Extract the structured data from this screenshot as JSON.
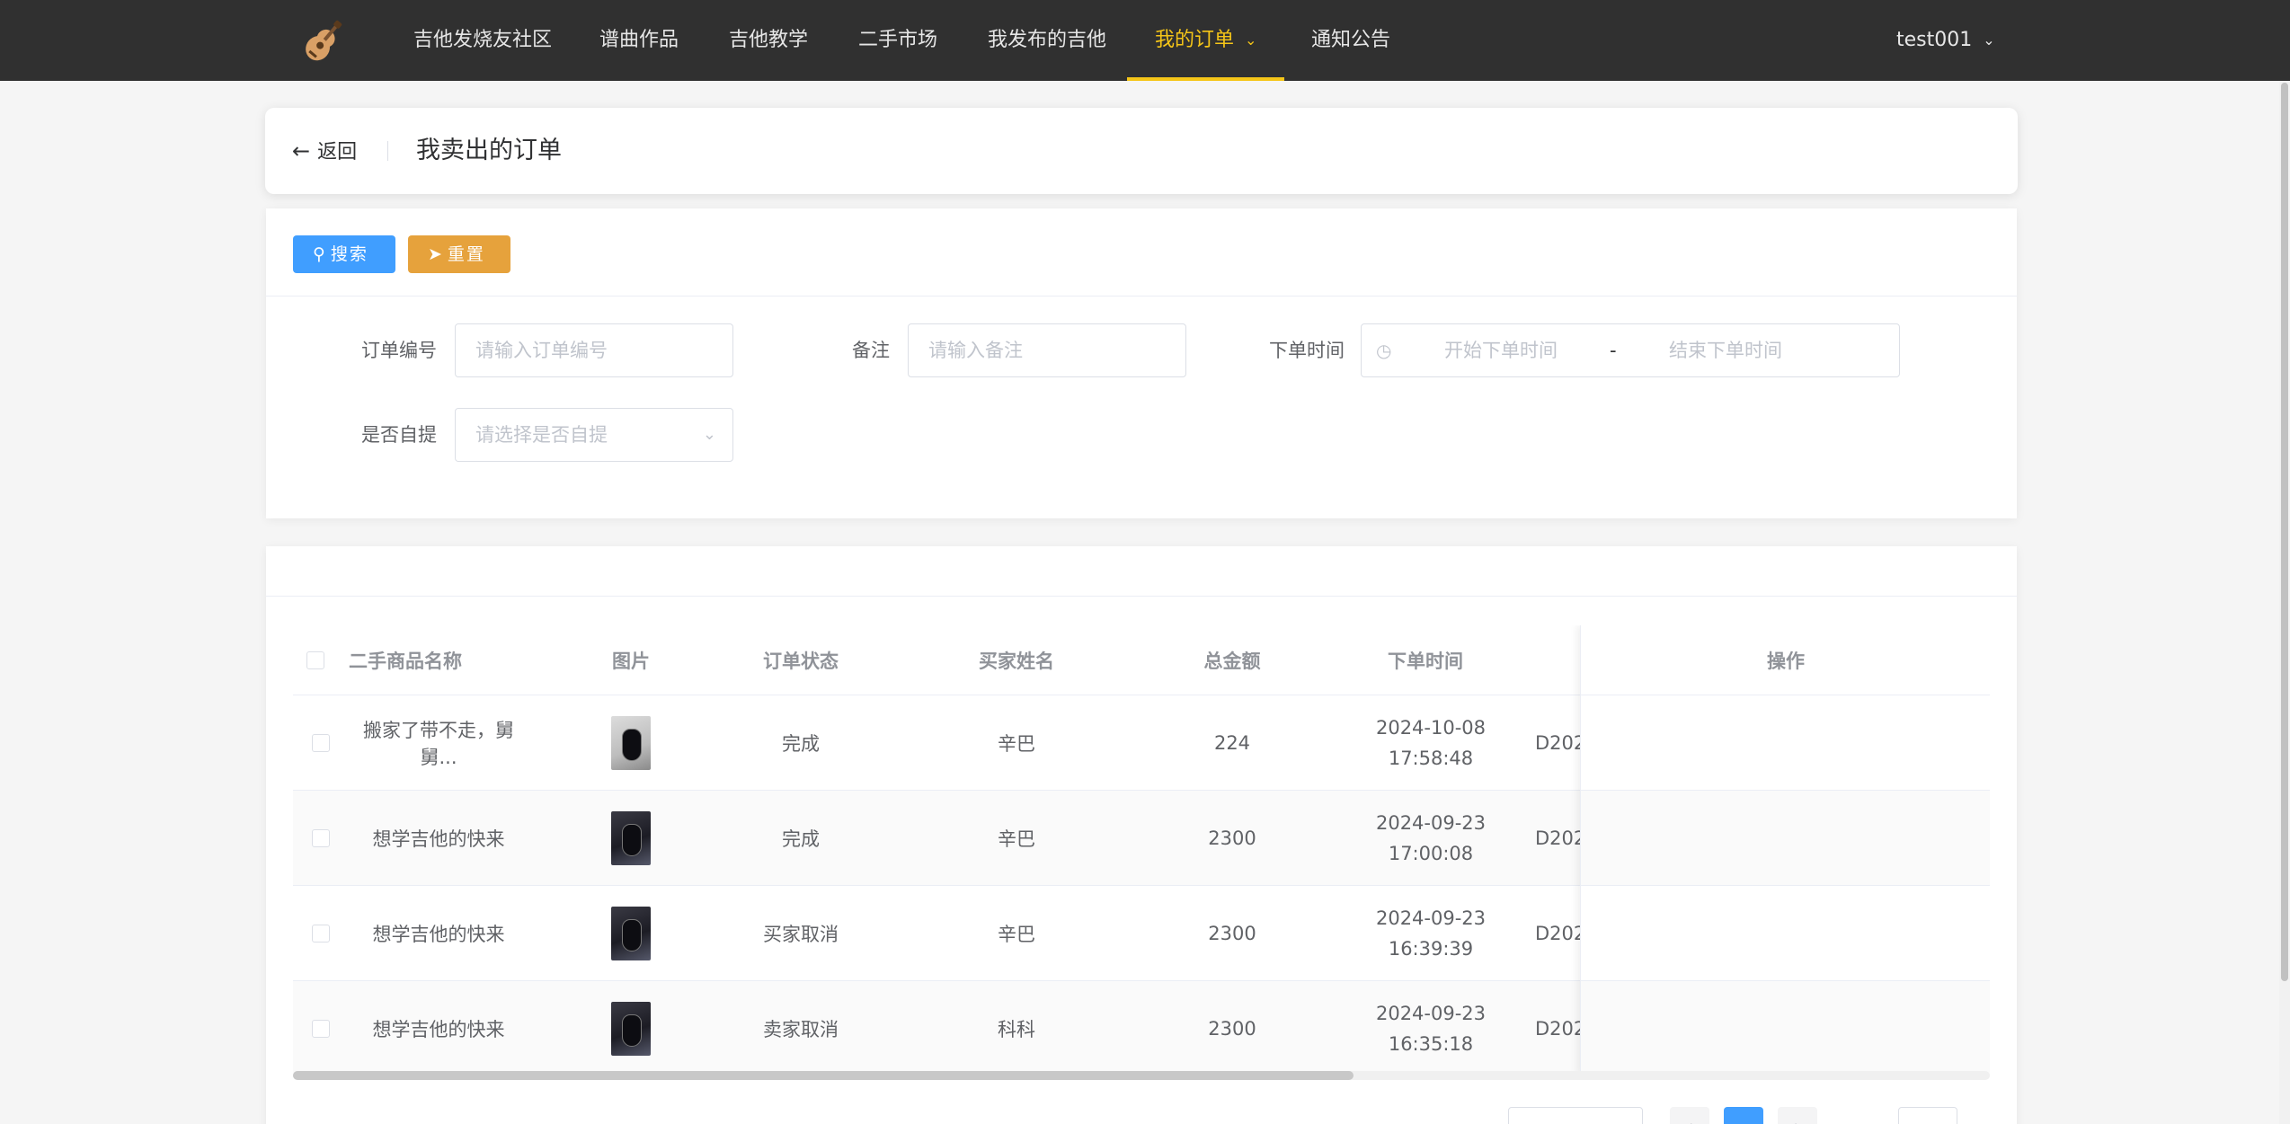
{
  "nav": {
    "items": [
      {
        "label": "吉他发烧友社区"
      },
      {
        "label": "谱曲作品"
      },
      {
        "label": "吉他教学"
      },
      {
        "label": "二手市场"
      },
      {
        "label": "我发布的吉他"
      },
      {
        "label": "我的订单"
      },
      {
        "label": "通知公告"
      }
    ],
    "active_index": 5,
    "active_color": "#f5c518",
    "user": "test001"
  },
  "header": {
    "back_label": "返回",
    "title": "我卖出的订单"
  },
  "search": {
    "search_button": "搜索",
    "reset_button": "重置",
    "fields": {
      "order_no": {
        "label": "订单编号",
        "placeholder": "请输入订单编号"
      },
      "remark": {
        "label": "备注",
        "placeholder": "请输入备注"
      },
      "order_time": {
        "label": "下单时间",
        "start_placeholder": "开始下单时间",
        "separator": "-",
        "end_placeholder": "结束下单时间"
      },
      "self_pickup": {
        "label": "是否自提",
        "placeholder": "请选择是否自提"
      }
    }
  },
  "table": {
    "columns": {
      "name": "二手商品名称",
      "image": "图片",
      "status": "订单状态",
      "buyer": "买家姓名",
      "amount": "总金额",
      "time": "下单时间",
      "actions": "操作"
    },
    "rows": [
      {
        "name": "搬家了带不走，舅舅...",
        "status": "完成",
        "buyer": "辛巴",
        "amount": "224",
        "time": "2024-10-08 17:58:48",
        "order_no": "D202"
      },
      {
        "name": "想学吉他的快来",
        "status": "完成",
        "buyer": "辛巴",
        "amount": "2300",
        "time": "2024-09-23 17:00:08",
        "order_no": "D202"
      },
      {
        "name": "想学吉他的快来",
        "status": "买家取消",
        "buyer": "辛巴",
        "amount": "2300",
        "time": "2024-09-23 16:39:39",
        "order_no": "D202"
      },
      {
        "name": "想学吉他的快来",
        "status": "卖家取消",
        "buyer": "科科",
        "amount": "2300",
        "time": "2024-09-23 16:35:18",
        "order_no": "D202"
      }
    ]
  },
  "colors": {
    "topbar": "#303030",
    "primary": "#409eff",
    "warning": "#e6a23c"
  }
}
